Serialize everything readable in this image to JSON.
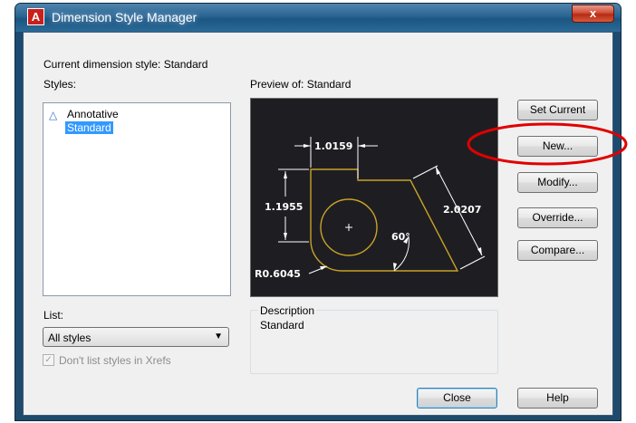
{
  "window": {
    "title": "Dimension Style Manager",
    "app_icon_text": "A",
    "close_glyph": "x"
  },
  "current_style": {
    "label": "Current dimension style: Standard"
  },
  "styles": {
    "label": "Styles:",
    "items": [
      {
        "label": "Annotative",
        "icon": "annotative-icon",
        "selected": false
      },
      {
        "label": "Standard",
        "selected": true
      }
    ]
  },
  "preview": {
    "label": "Preview of: Standard",
    "dimensions": {
      "top_width": "1.0159",
      "left_height": "1.1955",
      "diagonal": "2.0207",
      "angle": "60°",
      "radius": "R0.6045"
    },
    "colors": {
      "background": "#1e1e22",
      "geometry": "#c9a227",
      "dims": "#ffffff"
    }
  },
  "buttons": {
    "set_current": "Set Current",
    "new": "New...",
    "modify": "Modify...",
    "override": "Override...",
    "compare": "Compare...",
    "close": "Close",
    "help": "Help"
  },
  "description": {
    "legend": "Description",
    "text": "Standard"
  },
  "list": {
    "label": "List:",
    "selected": "All styles",
    "arrow": "▼"
  },
  "xrefs_checkbox": {
    "label": "Don't list styles in Xrefs",
    "checked": true,
    "enabled": false,
    "glyph": "✓"
  },
  "annotation": {
    "shape": "ellipse",
    "color": "#e00000"
  }
}
